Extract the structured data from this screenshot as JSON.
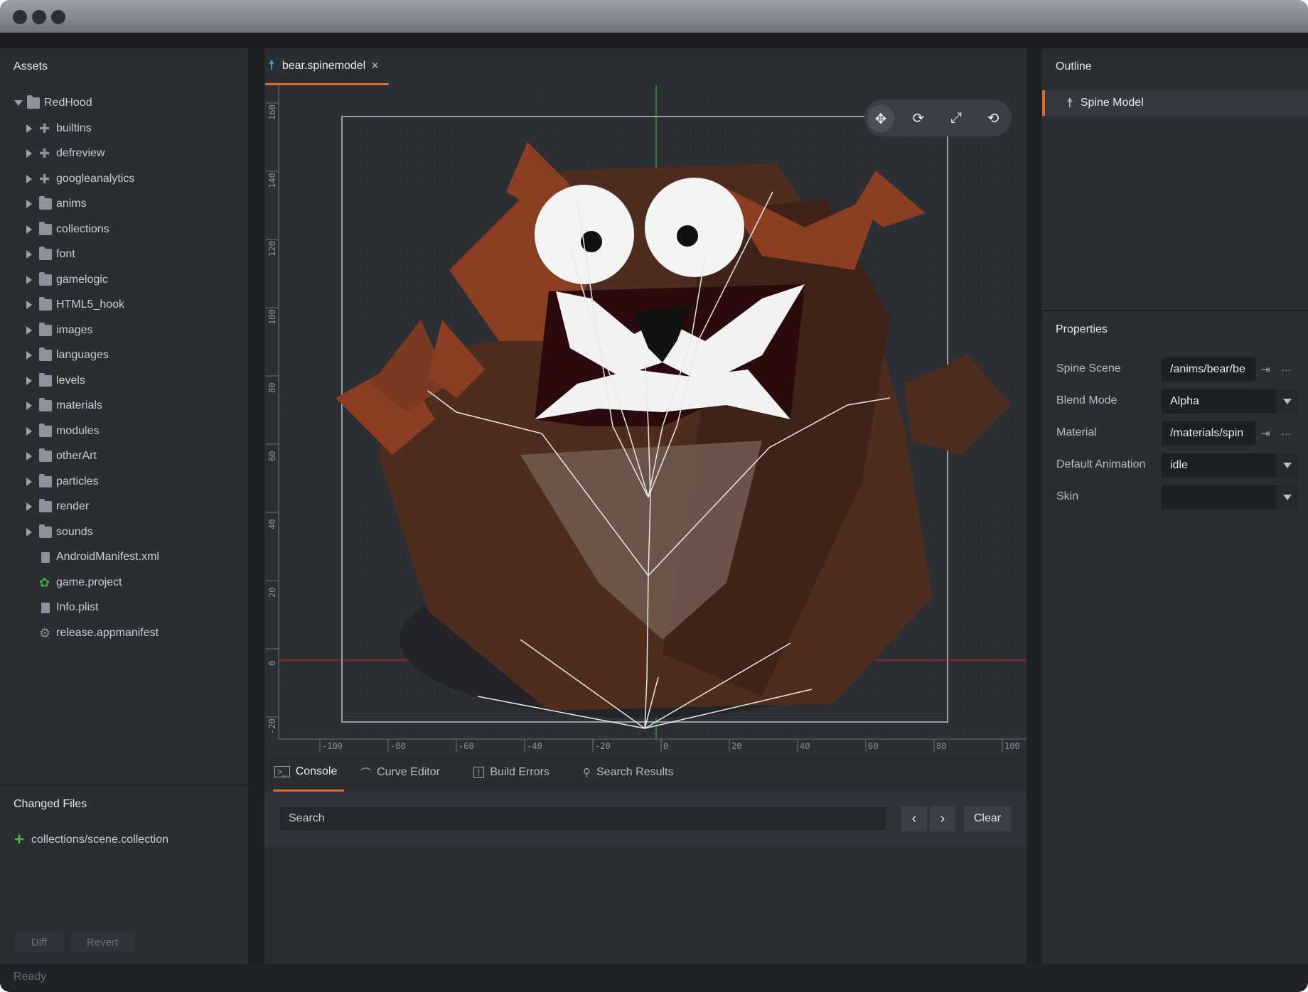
{
  "window": {
    "title": ""
  },
  "assets": {
    "title": "Assets",
    "tree": [
      {
        "label": "RedHood",
        "type": "folder",
        "expanded": true,
        "depth": 0
      },
      {
        "label": "builtins",
        "type": "library",
        "depth": 1
      },
      {
        "label": "defreview",
        "type": "library",
        "depth": 1
      },
      {
        "label": "googleanalytics",
        "type": "library",
        "depth": 1
      },
      {
        "label": "anims",
        "type": "folder",
        "depth": 1
      },
      {
        "label": "collections",
        "type": "folder",
        "depth": 1
      },
      {
        "label": "font",
        "type": "folder",
        "depth": 1
      },
      {
        "label": "gamelogic",
        "type": "folder",
        "depth": 1
      },
      {
        "label": "HTML5_hook",
        "type": "folder",
        "depth": 1
      },
      {
        "label": "images",
        "type": "folder",
        "depth": 1
      },
      {
        "label": "languages",
        "type": "folder",
        "depth": 1
      },
      {
        "label": "levels",
        "type": "folder",
        "depth": 1
      },
      {
        "label": "materials",
        "type": "folder",
        "depth": 1
      },
      {
        "label": "modules",
        "type": "folder",
        "depth": 1
      },
      {
        "label": "otherArt",
        "type": "folder",
        "depth": 1
      },
      {
        "label": "particles",
        "type": "folder",
        "depth": 1
      },
      {
        "label": "render",
        "type": "folder",
        "depth": 1
      },
      {
        "label": "sounds",
        "type": "folder",
        "depth": 1
      },
      {
        "label": "AndroidManifest.xml",
        "type": "file",
        "depth": 1
      },
      {
        "label": "game.project",
        "type": "game",
        "depth": 1
      },
      {
        "label": "Info.plist",
        "type": "file",
        "depth": 1
      },
      {
        "label": "release.appmanifest",
        "type": "gear",
        "depth": 1
      }
    ]
  },
  "changed_files": {
    "title": "Changed Files",
    "items": [
      "collections/scene.collection"
    ],
    "diff_label": "Diff",
    "revert_label": "Revert"
  },
  "editor": {
    "tab_label": "bear.spinemodel",
    "tab_close": "×",
    "tools": [
      "move-icon",
      "rotate-icon",
      "scale-icon",
      "perspective-icon"
    ],
    "x_ticks": [
      "-100",
      "-80",
      "-60",
      "-40",
      "-20",
      "0",
      "20",
      "40",
      "60",
      "80",
      "100"
    ],
    "y_ticks": [
      "160",
      "140",
      "120",
      "100",
      "80",
      "60",
      "40",
      "20",
      "0",
      "-20"
    ]
  },
  "bottom_panel": {
    "tabs": [
      {
        "label": "Console",
        "icon": "console-icon",
        "active": true
      },
      {
        "label": "Curve Editor",
        "icon": "curve-icon"
      },
      {
        "label": "Build Errors",
        "icon": "build-errors-icon"
      },
      {
        "label": "Search Results",
        "icon": "search-icon"
      }
    ],
    "search_placeholder": "Search",
    "prev_label": "‹",
    "next_label": "›",
    "clear_label": "Clear"
  },
  "outline": {
    "title": "Outline",
    "items": [
      {
        "label": "Spine Model",
        "icon": "spine-model-icon",
        "selected": true
      }
    ]
  },
  "properties": {
    "title": "Properties",
    "rows": [
      {
        "label": "Spine Scene",
        "value": "/anims/bear/be",
        "kind": "resource"
      },
      {
        "label": "Blend Mode",
        "value": "Alpha",
        "kind": "select"
      },
      {
        "label": "Material",
        "value": "/materials/spin",
        "kind": "resource"
      },
      {
        "label": "Default Animation",
        "value": "idle",
        "kind": "select"
      },
      {
        "label": "Skin",
        "value": "",
        "kind": "select"
      }
    ]
  },
  "status": {
    "text": "Ready"
  },
  "colors": {
    "accent": "#e0692a",
    "added": "#3fbf3f",
    "bear_brown": "#5a3220",
    "bear_rust": "#8b3e22"
  }
}
